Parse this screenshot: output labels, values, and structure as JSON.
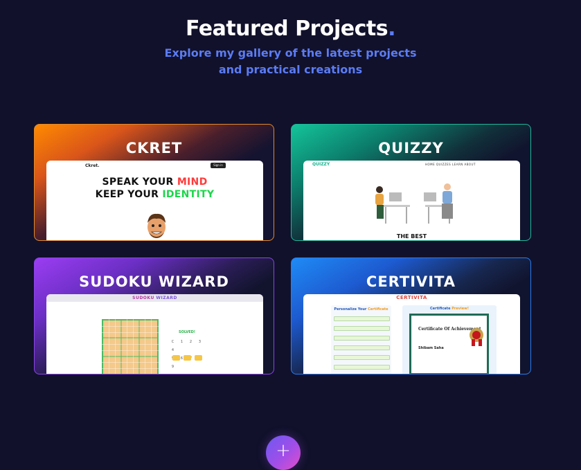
{
  "header": {
    "title": "Featured Projects",
    "title_dot": ".",
    "subtitle": "Explore my gallery of the latest projects and practical creations"
  },
  "projects": [
    {
      "title": "CKRET",
      "preview": {
        "logo": "Ckret.",
        "nav_button": "Sign in",
        "line1_prefix": "SPEAK YOUR ",
        "line1_accent": "MIND",
        "line2_prefix": "KEEP YOUR ",
        "line2_accent": "IDENTITY"
      },
      "accent": "#ff8a00"
    },
    {
      "title": "QUIZZY",
      "preview": {
        "logo": "QUIZZY",
        "nav_links": "HOME   QUIZZES   LEARN   ABOUT",
        "tagline": "THE BEST"
      },
      "accent": "#14c49a"
    },
    {
      "title": "SUDOKU WIZARD",
      "preview": {
        "app_title": "SUDOKU ",
        "app_title_accent": "WIZARD",
        "status": "SOLVED!",
        "number_pad": [
          "C",
          "1",
          "2",
          "3",
          "4",
          "5",
          "6",
          "7",
          "8",
          "9"
        ]
      },
      "accent": "#9b3df2"
    },
    {
      "title": "CERTIVITA",
      "preview": {
        "app_title": "CERTIVITA",
        "form_title": "Personalize Your ",
        "form_title_accent": "Certificate",
        "preview_title": "Certificate ",
        "preview_title_accent": "Preview!",
        "certificate_heading": "Certificate Of Achievement",
        "recipient": "Shibam Saha"
      },
      "accent": "#1f8bf5"
    }
  ],
  "add_button": "+"
}
